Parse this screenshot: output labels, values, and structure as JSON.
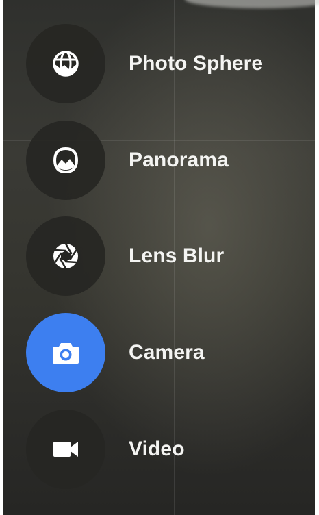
{
  "colors": {
    "active_mode_bg": "#3d7ff0",
    "mode_circle_bg": "#262623",
    "label_color": "#f4f4f2"
  },
  "modes": [
    {
      "label": "Photo Sphere",
      "icon": "photo-sphere-icon",
      "active": false
    },
    {
      "label": "Panorama",
      "icon": "panorama-icon",
      "active": false
    },
    {
      "label": "Lens Blur",
      "icon": "aperture-icon",
      "active": false
    },
    {
      "label": "Camera",
      "icon": "camera-icon",
      "active": true
    },
    {
      "label": "Video",
      "icon": "videocam-icon",
      "active": false
    }
  ]
}
